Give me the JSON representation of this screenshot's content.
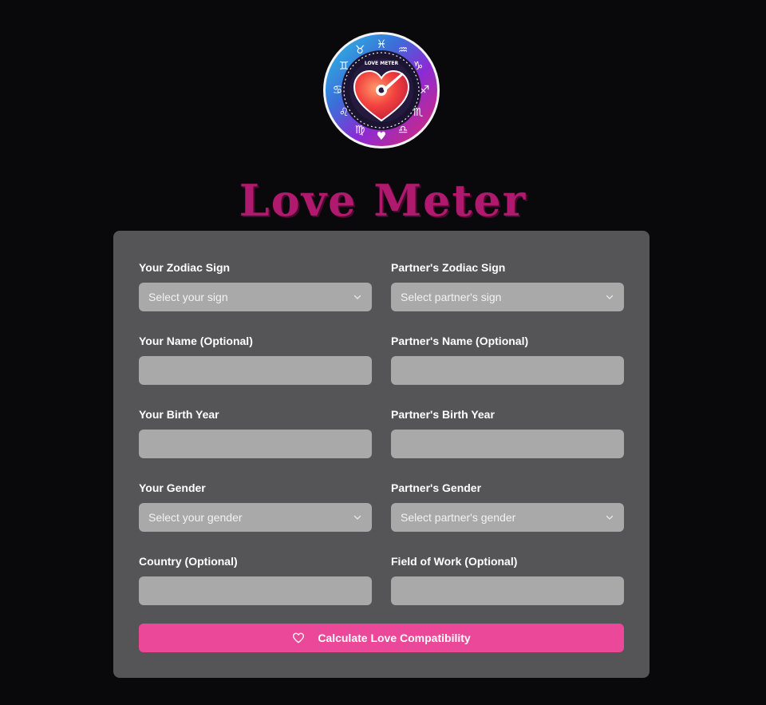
{
  "app": {
    "title": "Love Meter",
    "logo_text": "LOVE METER"
  },
  "form": {
    "your_sign": {
      "label": "Your Zodiac Sign",
      "placeholder": "Select your sign"
    },
    "partner_sign": {
      "label": "Partner's Zodiac Sign",
      "placeholder": "Select partner's sign"
    },
    "your_name": {
      "label": "Your Name (Optional)",
      "value": ""
    },
    "partner_name": {
      "label": "Partner's Name (Optional)",
      "value": ""
    },
    "your_birth_year": {
      "label": "Your Birth Year",
      "value": ""
    },
    "partner_birth_year": {
      "label": "Partner's Birth Year",
      "value": ""
    },
    "your_gender": {
      "label": "Your Gender",
      "placeholder": "Select your gender"
    },
    "partner_gender": {
      "label": "Partner's Gender",
      "placeholder": "Select partner's gender"
    },
    "country": {
      "label": "Country (Optional)",
      "value": ""
    },
    "field_of_work": {
      "label": "Field of Work (Optional)",
      "value": ""
    },
    "submit_label": "Calculate Love Compatibility"
  },
  "colors": {
    "background": "#09090b",
    "card": "#555557",
    "input": "#a9a9a9",
    "accent": "#ec4899",
    "title": "#b01a6e"
  },
  "icons": {
    "logo": "zodiac-heart-meter-logo",
    "dropdown": "chevron-down-icon",
    "submit": "heart-outline-icon"
  }
}
